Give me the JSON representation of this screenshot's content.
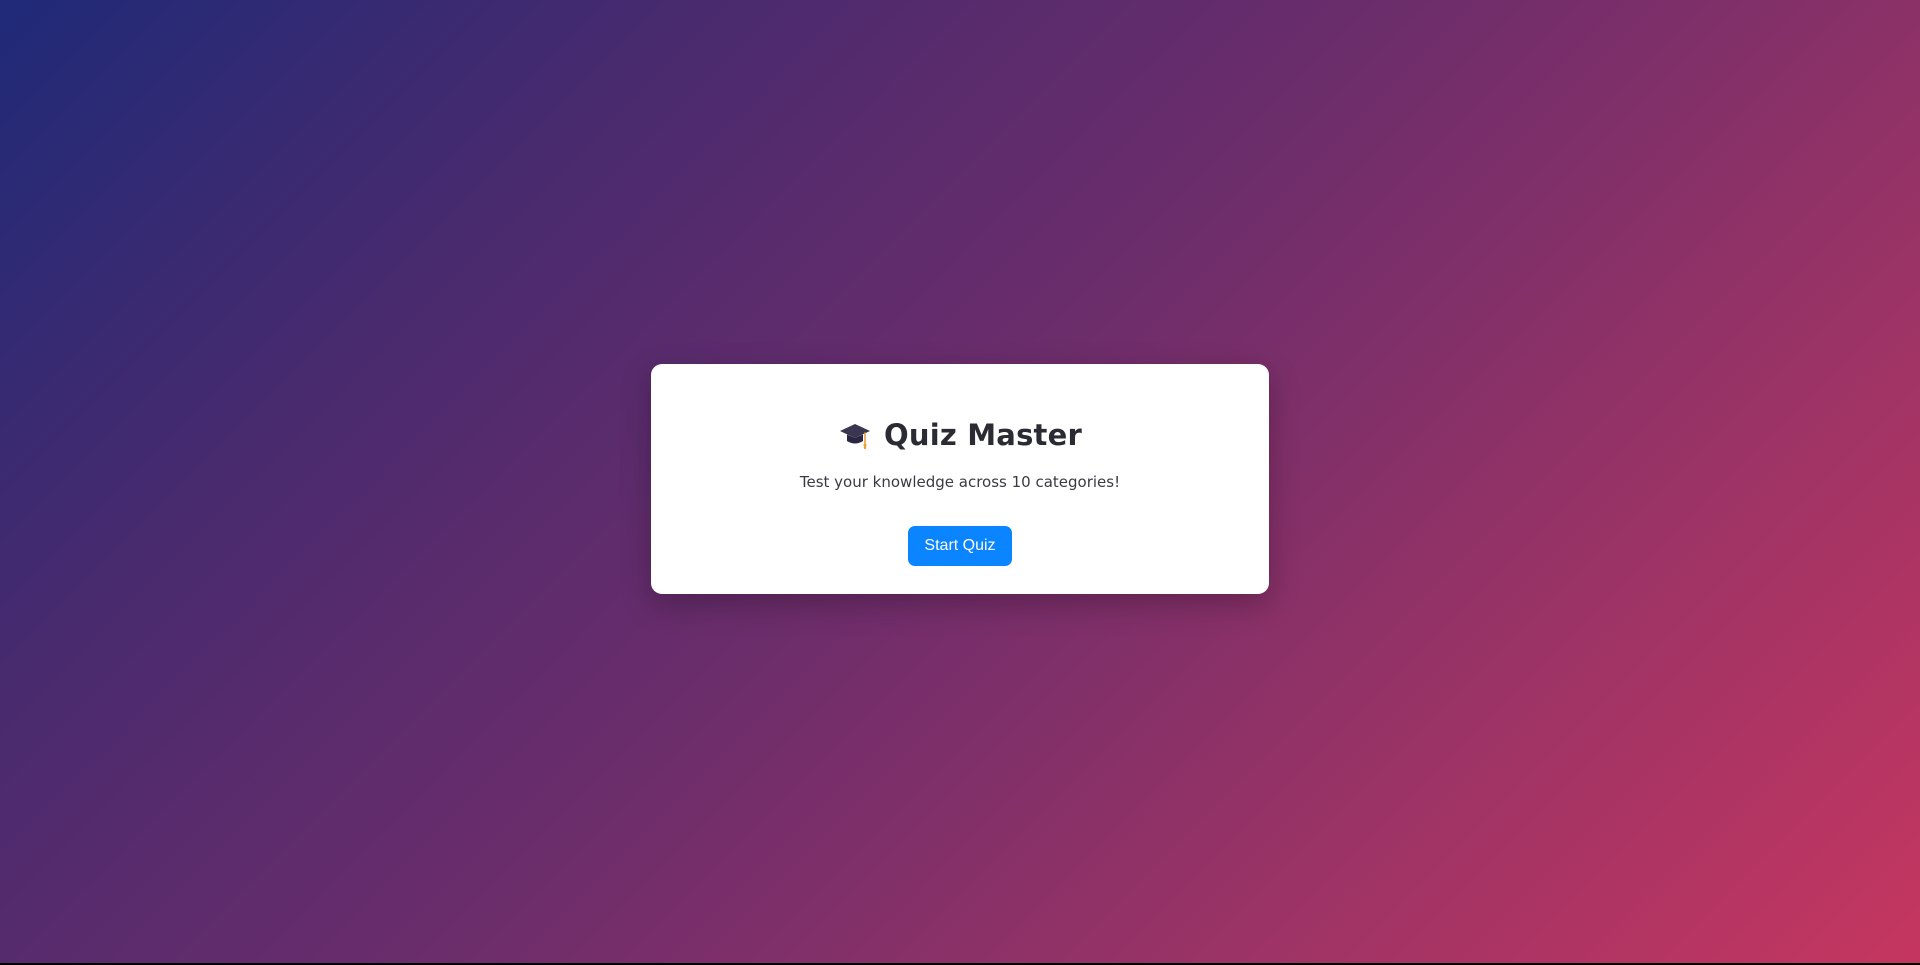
{
  "quiz": {
    "icon": "graduation-cap-icon",
    "title": "Quiz Master",
    "subtitle": "Test your knowledge across 10 categories!",
    "start_label": "Start Quiz"
  },
  "colors": {
    "accent": "#0a84ff",
    "card_bg": "#ffffff",
    "gradient_start": "#1f2a78",
    "gradient_end": "#c53660"
  }
}
